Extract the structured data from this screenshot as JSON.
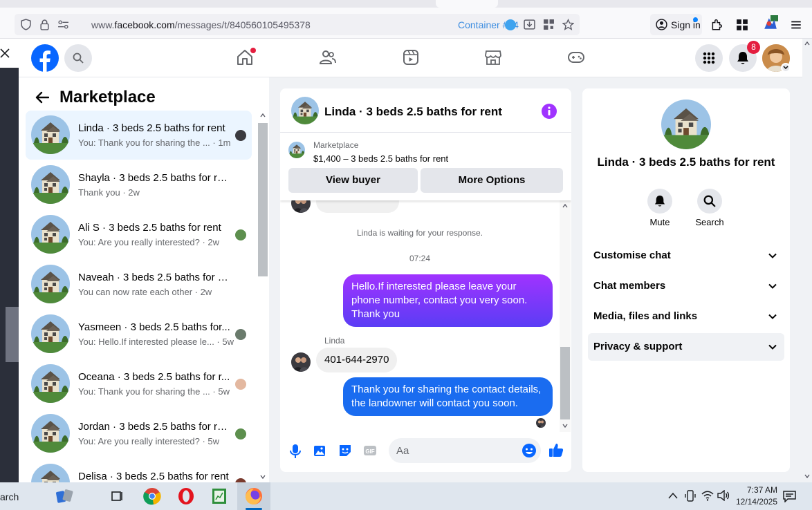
{
  "browser": {
    "url_prefix": "www.",
    "url_domain": "facebook.com",
    "url_path": "/messages/t/840560105495378",
    "container": "Container #74",
    "sign_in": "Sign in"
  },
  "nav": {
    "notifications_count": "8"
  },
  "sidebar": {
    "title": "Marketplace",
    "conversations": [
      {
        "name": "Linda · 3 beds 2.5 baths for rent",
        "snippet": "You: Thank you for sharing the ... · 1m"
      },
      {
        "name": "Shayla · 3 beds 2.5 baths for rent",
        "snippet": "Thank you · 2w"
      },
      {
        "name": "Ali S · 3 beds 2.5 baths for rent",
        "snippet": "You: Are you really interested? · 2w"
      },
      {
        "name": "Naveah · 3 beds 2.5 baths for rent",
        "snippet": "You can now rate each other · 2w"
      },
      {
        "name": "Yasmeen · 3 beds 2.5 baths for...",
        "snippet": "You: Hello.If interested please le... · 5w"
      },
      {
        "name": "Oceana · 3 beds 2.5 baths for r...",
        "snippet": "You: Thank you for sharing the ... · 5w"
      },
      {
        "name": "Jordan · 3 beds 2.5 baths for re...",
        "snippet": "You: Are you really interested? · 5w"
      },
      {
        "name": "Delisa · 3 beds 2.5 baths for rent",
        "snippet": ""
      }
    ]
  },
  "chat": {
    "title": "Linda · 3 beds 2.5 baths for rent",
    "market_label": "Marketplace",
    "listing": "$1,400 – 3 beds 2.5 baths for rent",
    "view_buyer": "View buyer",
    "more_options": "More Options",
    "waiting": "Linda is waiting for your response.",
    "time": "07:24",
    "msg1": "Hello.If interested please leave your phone number, contact you very soon. Thank you",
    "sender": "Linda",
    "msg2": "401-644-2970",
    "msg3": "Thank you for sharing the contact details, the landowner will contact you soon.",
    "placeholder": "Aa"
  },
  "info": {
    "title": "Linda · 3 beds 2.5 baths for rent",
    "mute": "Mute",
    "search": "Search",
    "sections": [
      "Customise chat",
      "Chat members",
      "Media, files and links",
      "Privacy & support"
    ]
  },
  "taskbar": {
    "search_fragment": "arch",
    "time": "7:37 AM",
    "date": "12/14/2025"
  },
  "colors": {
    "facebook_blue": "#0866ff",
    "messenger_purple": "#a033ff",
    "badge_red": "#e41e3f"
  }
}
